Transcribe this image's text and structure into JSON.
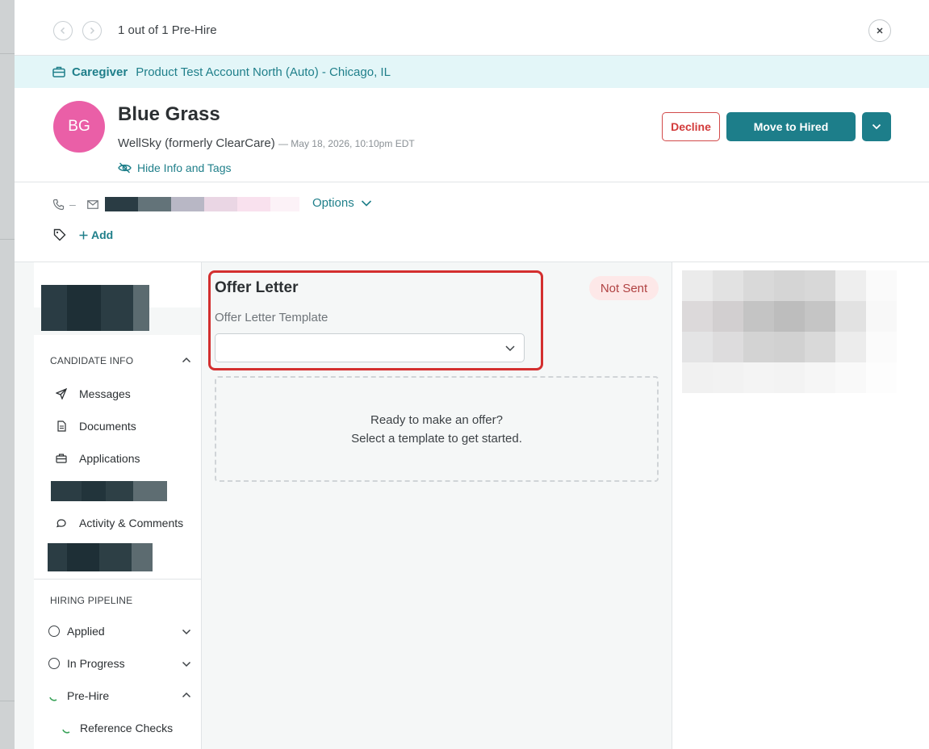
{
  "nav": {
    "counter": "1 out of 1 Pre-Hire"
  },
  "banner": {
    "role": "Caregiver",
    "account": "Product Test Account North (Auto) - Chicago, IL"
  },
  "candidate": {
    "initials": "BG",
    "name": "Blue Grass",
    "company": "WellSky (formerly ClearCare)",
    "date": "— May 18, 2026, 10:10pm EDT",
    "hide_info_label": "Hide Info and Tags",
    "phone": "–"
  },
  "actions": {
    "decline_label": "Decline",
    "move_label": "Move to Hired"
  },
  "contact": {
    "options_label": "Options",
    "add_tag_label": "Add"
  },
  "sidebar": {
    "candidate_info_header": "CANDIDATE INFO",
    "items": [
      {
        "label": "Messages",
        "icon": "send-icon"
      },
      {
        "label": "Documents",
        "icon": "document-icon"
      },
      {
        "label": "Applications",
        "icon": "briefcase-icon"
      },
      {
        "label": "Activity & Comments",
        "icon": "comment-icon"
      }
    ],
    "pipeline_header": "HIRING PIPELINE",
    "pipeline": [
      {
        "label": "Applied",
        "state": "collapsed"
      },
      {
        "label": "In Progress",
        "state": "collapsed"
      },
      {
        "label": "Pre-Hire",
        "state": "expanded"
      }
    ],
    "sub_items": [
      {
        "label": "Reference Checks"
      }
    ]
  },
  "offer": {
    "title": "Offer Letter",
    "template_label": "Offer Letter Template",
    "template_value": "",
    "status": "Not Sent",
    "empty_line1": "Ready to make an offer?",
    "empty_line2": "Select a template to get started."
  },
  "colors": {
    "accent": "#1d7e8a",
    "avatar": "#ea5fa7",
    "decline": "#d23a3a",
    "highlight": "#d32f2f",
    "banner_bg": "#e3f6f8"
  }
}
